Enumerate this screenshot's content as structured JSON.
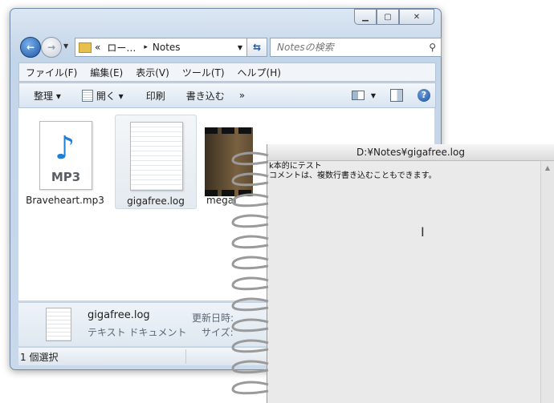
{
  "explorer": {
    "address": {
      "chevrons": "«",
      "crumb1": "ロー…",
      "sep": "▸",
      "crumb2": "Notes"
    },
    "search_placeholder": "Notesの検索",
    "menu": [
      "ファイル(F)",
      "編集(E)",
      "表示(V)",
      "ツール(T)",
      "ヘルプ(H)"
    ],
    "commands": {
      "organize": "整理 ▾",
      "open": "開く ▾",
      "print": "印刷",
      "burn": "書き込む",
      "more": "»"
    },
    "files": [
      {
        "name": "Braveheart.mp3",
        "badge": "MP3"
      },
      {
        "name": "gigafree.log"
      },
      {
        "name": "megaf"
      }
    ],
    "details": {
      "name": "gigafree.log",
      "type": "テキスト ドキュメント",
      "modified_label": "更新日時:",
      "size_label": "サイズ:"
    },
    "status": "1 個選択"
  },
  "notepad": {
    "title": "D:¥Notes¥gigafree.log",
    "lines": [
      "k本的にテスト",
      "コメントは、複数行書き込むこともできます。"
    ]
  },
  "colors": {
    "accent": "#1c56a8",
    "content_bg": "#ffffff",
    "notepad_bg": "#eaeaea"
  }
}
